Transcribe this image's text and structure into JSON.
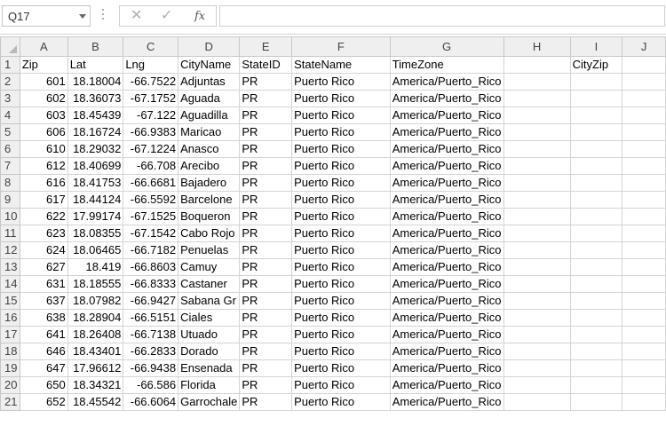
{
  "name_box": "Q17",
  "formula_bar": {
    "cancel_icon": "✕",
    "enter_icon": "✓",
    "fx_label": "fx",
    "formula": ""
  },
  "columns": [
    "A",
    "B",
    "C",
    "D",
    "E",
    "F",
    "G",
    "H",
    "I",
    "J"
  ],
  "rows": [
    {
      "n": "1",
      "a": "Zip",
      "b": "Lat",
      "c": "Lng",
      "d": "CityName",
      "e": "StateID",
      "f": "StateName",
      "g": "TimeZone",
      "h": "",
      "i": "CityZip",
      "j": ""
    },
    {
      "n": "2",
      "a": "601",
      "b": "18.18004",
      "c": "-66.7522",
      "d": "Adjuntas",
      "e": "PR",
      "f": "Puerto Rico",
      "g": "America/Puerto_Rico",
      "h": "",
      "i": "",
      "j": ""
    },
    {
      "n": "3",
      "a": "602",
      "b": "18.36073",
      "c": "-67.1752",
      "d": "Aguada",
      "e": "PR",
      "f": "Puerto Rico",
      "g": "America/Puerto_Rico",
      "h": "",
      "i": "",
      "j": ""
    },
    {
      "n": "4",
      "a": "603",
      "b": "18.45439",
      "c": "-67.122",
      "d": "Aguadilla",
      "e": "PR",
      "f": "Puerto Rico",
      "g": "America/Puerto_Rico",
      "h": "",
      "i": "",
      "j": ""
    },
    {
      "n": "5",
      "a": "606",
      "b": "18.16724",
      "c": "-66.9383",
      "d": "Maricao",
      "e": "PR",
      "f": "Puerto Rico",
      "g": "America/Puerto_Rico",
      "h": "",
      "i": "",
      "j": ""
    },
    {
      "n": "6",
      "a": "610",
      "b": "18.29032",
      "c": "-67.1224",
      "d": "Anasco",
      "e": "PR",
      "f": "Puerto Rico",
      "g": "America/Puerto_Rico",
      "h": "",
      "i": "",
      "j": ""
    },
    {
      "n": "7",
      "a": "612",
      "b": "18.40699",
      "c": "-66.708",
      "d": "Arecibo",
      "e": "PR",
      "f": "Puerto Rico",
      "g": "America/Puerto_Rico",
      "h": "",
      "i": "",
      "j": ""
    },
    {
      "n": "8",
      "a": "616",
      "b": "18.41753",
      "c": "-66.6681",
      "d": "Bajadero",
      "e": "PR",
      "f": "Puerto Rico",
      "g": "America/Puerto_Rico",
      "h": "",
      "i": "",
      "j": ""
    },
    {
      "n": "9",
      "a": "617",
      "b": "18.44124",
      "c": "-66.5592",
      "d": "Barcelone",
      "e": "PR",
      "f": "Puerto Rico",
      "g": "America/Puerto_Rico",
      "h": "",
      "i": "",
      "j": ""
    },
    {
      "n": "10",
      "a": "622",
      "b": "17.99174",
      "c": "-67.1525",
      "d": "Boqueron",
      "e": "PR",
      "f": "Puerto Rico",
      "g": "America/Puerto_Rico",
      "h": "",
      "i": "",
      "j": ""
    },
    {
      "n": "11",
      "a": "623",
      "b": "18.08355",
      "c": "-67.1542",
      "d": "Cabo Rojo",
      "e": "PR",
      "f": "Puerto Rico",
      "g": "America/Puerto_Rico",
      "h": "",
      "i": "",
      "j": ""
    },
    {
      "n": "12",
      "a": "624",
      "b": "18.06465",
      "c": "-66.7182",
      "d": "Penuelas",
      "e": "PR",
      "f": "Puerto Rico",
      "g": "America/Puerto_Rico",
      "h": "",
      "i": "",
      "j": ""
    },
    {
      "n": "13",
      "a": "627",
      "b": "18.419",
      "c": "-66.8603",
      "d": "Camuy",
      "e": "PR",
      "f": "Puerto Rico",
      "g": "America/Puerto_Rico",
      "h": "",
      "i": "",
      "j": ""
    },
    {
      "n": "14",
      "a": "631",
      "b": "18.18555",
      "c": "-66.8333",
      "d": "Castaner",
      "e": "PR",
      "f": "Puerto Rico",
      "g": "America/Puerto_Rico",
      "h": "",
      "i": "",
      "j": ""
    },
    {
      "n": "15",
      "a": "637",
      "b": "18.07982",
      "c": "-66.9427",
      "d": "Sabana Gr",
      "e": "PR",
      "f": "Puerto Rico",
      "g": "America/Puerto_Rico",
      "h": "",
      "i": "",
      "j": ""
    },
    {
      "n": "16",
      "a": "638",
      "b": "18.28904",
      "c": "-66.5151",
      "d": "Ciales",
      "e": "PR",
      "f": "Puerto Rico",
      "g": "America/Puerto_Rico",
      "h": "",
      "i": "",
      "j": ""
    },
    {
      "n": "17",
      "a": "641",
      "b": "18.26408",
      "c": "-66.7138",
      "d": "Utuado",
      "e": "PR",
      "f": "Puerto Rico",
      "g": "America/Puerto_Rico",
      "h": "",
      "i": "",
      "j": ""
    },
    {
      "n": "18",
      "a": "646",
      "b": "18.43401",
      "c": "-66.2833",
      "d": "Dorado",
      "e": "PR",
      "f": "Puerto Rico",
      "g": "America/Puerto_Rico",
      "h": "",
      "i": "",
      "j": ""
    },
    {
      "n": "19",
      "a": "647",
      "b": "17.96612",
      "c": "-66.9438",
      "d": "Ensenada",
      "e": "PR",
      "f": "Puerto Rico",
      "g": "America/Puerto_Rico",
      "h": "",
      "i": "",
      "j": ""
    },
    {
      "n": "20",
      "a": "650",
      "b": "18.34321",
      "c": "-66.586",
      "d": "Florida",
      "e": "PR",
      "f": "Puerto Rico",
      "g": "America/Puerto_Rico",
      "h": "",
      "i": "",
      "j": ""
    },
    {
      "n": "21",
      "a": "652",
      "b": "18.45542",
      "c": "-66.6064",
      "d": "Garrochale",
      "e": "PR",
      "f": "Puerto Rico",
      "g": "America/Puerto_Rico",
      "h": "",
      "i": "",
      "j": ""
    }
  ]
}
